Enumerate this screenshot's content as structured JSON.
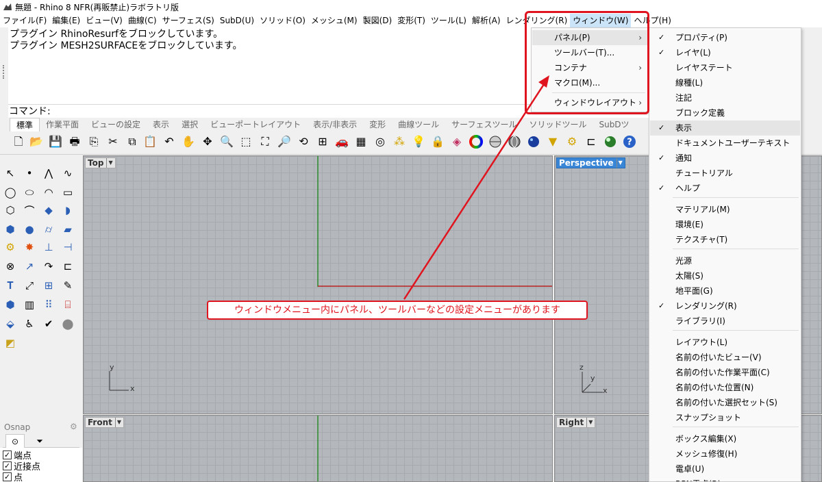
{
  "window": {
    "title": "無題 - Rhino 8 NFR(再販禁止)ラボラトリ版"
  },
  "menubar": [
    "ファイル(F)",
    "編集(E)",
    "ビュー(V)",
    "曲線(C)",
    "サーフェス(S)",
    "SubD(U)",
    "ソリッド(O)",
    "メッシュ(M)",
    "製図(D)",
    "変形(T)",
    "ツール(L)",
    "解析(A)",
    "レンダリング(R)",
    "ウィンドウ(W)",
    "ヘルプ(H)"
  ],
  "command": {
    "history": [
      "プラグイン RhinoResurfをブロックしています。",
      "プラグイン MESH2SURFACEをブロックしています。"
    ],
    "prompt": "コマンド:"
  },
  "tabs": [
    "標準",
    "作業平面",
    "ビューの設定",
    "表示",
    "選択",
    "ビューポートレイアウト",
    "表示/非表示",
    "変形",
    "曲線ツール",
    "サーフェスツール",
    "ソリッドツール",
    "SubDツ"
  ],
  "viewports": {
    "top": "Top",
    "perspective": "Perspective",
    "front": "Front",
    "right": "Right"
  },
  "axes": {
    "x": "x",
    "y": "y",
    "z": "z"
  },
  "osnap": {
    "title": "Osnap",
    "items": [
      {
        "label": "端点",
        "checked": true
      },
      {
        "label": "近接点",
        "checked": true
      },
      {
        "label": "点",
        "checked": true
      }
    ]
  },
  "window_menu": {
    "items": [
      {
        "label": "パネル(P)",
        "submenu": true,
        "hover": true
      },
      {
        "label": "ツールバー(T)...",
        "submenu": false
      },
      {
        "label": "コンテナ",
        "submenu": true
      },
      {
        "label": "マクロ(M)...",
        "submenu": false
      },
      {
        "label": "ウィンドウレイアウト",
        "submenu": true
      }
    ]
  },
  "panel_menu": {
    "items": [
      {
        "label": "プロパティ(P)",
        "checked": true
      },
      {
        "label": "レイヤ(L)",
        "checked": true
      },
      {
        "label": "レイヤステート",
        "checked": false
      },
      {
        "label": "線種(L)",
        "checked": false
      },
      {
        "label": "注記",
        "checked": false
      },
      {
        "label": "ブロック定義",
        "checked": false
      },
      {
        "label": "表示",
        "checked": true
      },
      {
        "label": "ドキュメントユーザーテキスト",
        "checked": false
      },
      {
        "label": "通知",
        "checked": true
      },
      {
        "label": "チュートリアル",
        "checked": false
      },
      {
        "label": "ヘルプ",
        "checked": true
      },
      {
        "label": "マテリアル(M)",
        "checked": false
      },
      {
        "label": "環境(E)",
        "checked": false
      },
      {
        "label": "テクスチャ(T)",
        "checked": false
      },
      {
        "label": "光源",
        "checked": false
      },
      {
        "label": "太陽(S)",
        "checked": false
      },
      {
        "label": "地平面(G)",
        "checked": false
      },
      {
        "label": "レンダリング(R)",
        "checked": true
      },
      {
        "label": "ライブラリ(I)",
        "checked": false
      },
      {
        "label": "レイアウト(L)",
        "checked": false
      },
      {
        "label": "名前の付いたビュー(V)",
        "checked": false
      },
      {
        "label": "名前の付いた作業平面(C)",
        "checked": false
      },
      {
        "label": "名前の付いた位置(N)",
        "checked": false
      },
      {
        "label": "名前の付いた選択セット(S)",
        "checked": false
      },
      {
        "label": "スナップショット",
        "checked": false
      },
      {
        "label": "ボックス編集(X)",
        "checked": false
      },
      {
        "label": "メッシュ修復(H)",
        "checked": false
      },
      {
        "label": "電卓(U)",
        "checked": false
      },
      {
        "label": "RPN電卓(R)",
        "checked": false
      }
    ]
  },
  "annotation": {
    "text": "ウィンドウメニュー内にパネル、ツールバーなどの設定メニューがあります",
    "color": "#e0141e"
  }
}
